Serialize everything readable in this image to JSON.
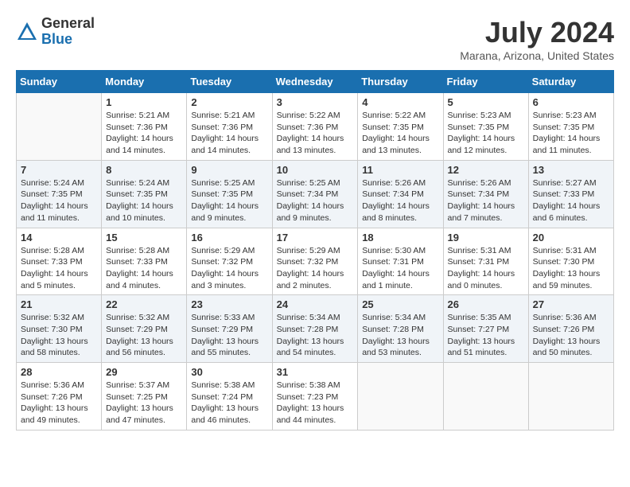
{
  "header": {
    "logo_general": "General",
    "logo_blue": "Blue",
    "month_year": "July 2024",
    "location": "Marana, Arizona, United States"
  },
  "calendar": {
    "days_of_week": [
      "Sunday",
      "Monday",
      "Tuesday",
      "Wednesday",
      "Thursday",
      "Friday",
      "Saturday"
    ],
    "weeks": [
      [
        {
          "day": "",
          "info": ""
        },
        {
          "day": "1",
          "info": "Sunrise: 5:21 AM\nSunset: 7:36 PM\nDaylight: 14 hours\nand 14 minutes."
        },
        {
          "day": "2",
          "info": "Sunrise: 5:21 AM\nSunset: 7:36 PM\nDaylight: 14 hours\nand 14 minutes."
        },
        {
          "day": "3",
          "info": "Sunrise: 5:22 AM\nSunset: 7:36 PM\nDaylight: 14 hours\nand 13 minutes."
        },
        {
          "day": "4",
          "info": "Sunrise: 5:22 AM\nSunset: 7:35 PM\nDaylight: 14 hours\nand 13 minutes."
        },
        {
          "day": "5",
          "info": "Sunrise: 5:23 AM\nSunset: 7:35 PM\nDaylight: 14 hours\nand 12 minutes."
        },
        {
          "day": "6",
          "info": "Sunrise: 5:23 AM\nSunset: 7:35 PM\nDaylight: 14 hours\nand 11 minutes."
        }
      ],
      [
        {
          "day": "7",
          "info": "Sunrise: 5:24 AM\nSunset: 7:35 PM\nDaylight: 14 hours\nand 11 minutes."
        },
        {
          "day": "8",
          "info": "Sunrise: 5:24 AM\nSunset: 7:35 PM\nDaylight: 14 hours\nand 10 minutes."
        },
        {
          "day": "9",
          "info": "Sunrise: 5:25 AM\nSunset: 7:35 PM\nDaylight: 14 hours\nand 9 minutes."
        },
        {
          "day": "10",
          "info": "Sunrise: 5:25 AM\nSunset: 7:34 PM\nDaylight: 14 hours\nand 9 minutes."
        },
        {
          "day": "11",
          "info": "Sunrise: 5:26 AM\nSunset: 7:34 PM\nDaylight: 14 hours\nand 8 minutes."
        },
        {
          "day": "12",
          "info": "Sunrise: 5:26 AM\nSunset: 7:34 PM\nDaylight: 14 hours\nand 7 minutes."
        },
        {
          "day": "13",
          "info": "Sunrise: 5:27 AM\nSunset: 7:33 PM\nDaylight: 14 hours\nand 6 minutes."
        }
      ],
      [
        {
          "day": "14",
          "info": "Sunrise: 5:28 AM\nSunset: 7:33 PM\nDaylight: 14 hours\nand 5 minutes."
        },
        {
          "day": "15",
          "info": "Sunrise: 5:28 AM\nSunset: 7:33 PM\nDaylight: 14 hours\nand 4 minutes."
        },
        {
          "day": "16",
          "info": "Sunrise: 5:29 AM\nSunset: 7:32 PM\nDaylight: 14 hours\nand 3 minutes."
        },
        {
          "day": "17",
          "info": "Sunrise: 5:29 AM\nSunset: 7:32 PM\nDaylight: 14 hours\nand 2 minutes."
        },
        {
          "day": "18",
          "info": "Sunrise: 5:30 AM\nSunset: 7:31 PM\nDaylight: 14 hours\nand 1 minute."
        },
        {
          "day": "19",
          "info": "Sunrise: 5:31 AM\nSunset: 7:31 PM\nDaylight: 14 hours\nand 0 minutes."
        },
        {
          "day": "20",
          "info": "Sunrise: 5:31 AM\nSunset: 7:30 PM\nDaylight: 13 hours\nand 59 minutes."
        }
      ],
      [
        {
          "day": "21",
          "info": "Sunrise: 5:32 AM\nSunset: 7:30 PM\nDaylight: 13 hours\nand 58 minutes."
        },
        {
          "day": "22",
          "info": "Sunrise: 5:32 AM\nSunset: 7:29 PM\nDaylight: 13 hours\nand 56 minutes."
        },
        {
          "day": "23",
          "info": "Sunrise: 5:33 AM\nSunset: 7:29 PM\nDaylight: 13 hours\nand 55 minutes."
        },
        {
          "day": "24",
          "info": "Sunrise: 5:34 AM\nSunset: 7:28 PM\nDaylight: 13 hours\nand 54 minutes."
        },
        {
          "day": "25",
          "info": "Sunrise: 5:34 AM\nSunset: 7:28 PM\nDaylight: 13 hours\nand 53 minutes."
        },
        {
          "day": "26",
          "info": "Sunrise: 5:35 AM\nSunset: 7:27 PM\nDaylight: 13 hours\nand 51 minutes."
        },
        {
          "day": "27",
          "info": "Sunrise: 5:36 AM\nSunset: 7:26 PM\nDaylight: 13 hours\nand 50 minutes."
        }
      ],
      [
        {
          "day": "28",
          "info": "Sunrise: 5:36 AM\nSunset: 7:26 PM\nDaylight: 13 hours\nand 49 minutes."
        },
        {
          "day": "29",
          "info": "Sunrise: 5:37 AM\nSunset: 7:25 PM\nDaylight: 13 hours\nand 47 minutes."
        },
        {
          "day": "30",
          "info": "Sunrise: 5:38 AM\nSunset: 7:24 PM\nDaylight: 13 hours\nand 46 minutes."
        },
        {
          "day": "31",
          "info": "Sunrise: 5:38 AM\nSunset: 7:23 PM\nDaylight: 13 hours\nand 44 minutes."
        },
        {
          "day": "",
          "info": ""
        },
        {
          "day": "",
          "info": ""
        },
        {
          "day": "",
          "info": ""
        }
      ]
    ]
  }
}
